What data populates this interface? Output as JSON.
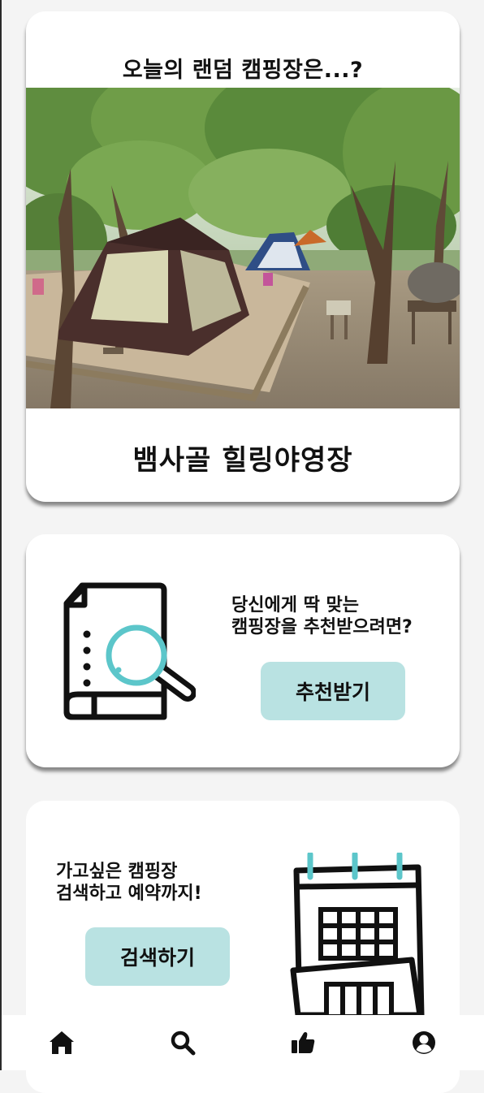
{
  "random_card": {
    "title": "오늘의 랜덤 캠핑장은...?",
    "camp_name": "뱀사골 힐링야영장",
    "photo": "campsite-photo-tents-under-trees"
  },
  "recommend_card": {
    "line1": "당신에게 딱 맞는",
    "line2": "캠핑장을 추천받으려면?",
    "button_label": "추천받기",
    "icon": "document-search-icon"
  },
  "search_card": {
    "line1": "가고싶은 캠핑장",
    "line2": "검색하고 예약까지!",
    "button_label": "검색하기",
    "icon": "calendar-icon"
  },
  "bottom_nav": {
    "items": [
      "home-icon",
      "search-icon",
      "thumbs-up-icon",
      "profile-icon"
    ]
  },
  "colors": {
    "accent": "#b9e2e2",
    "magnifier": "#5cc6ca",
    "background": "#f4f4f4",
    "card": "#ffffff"
  }
}
